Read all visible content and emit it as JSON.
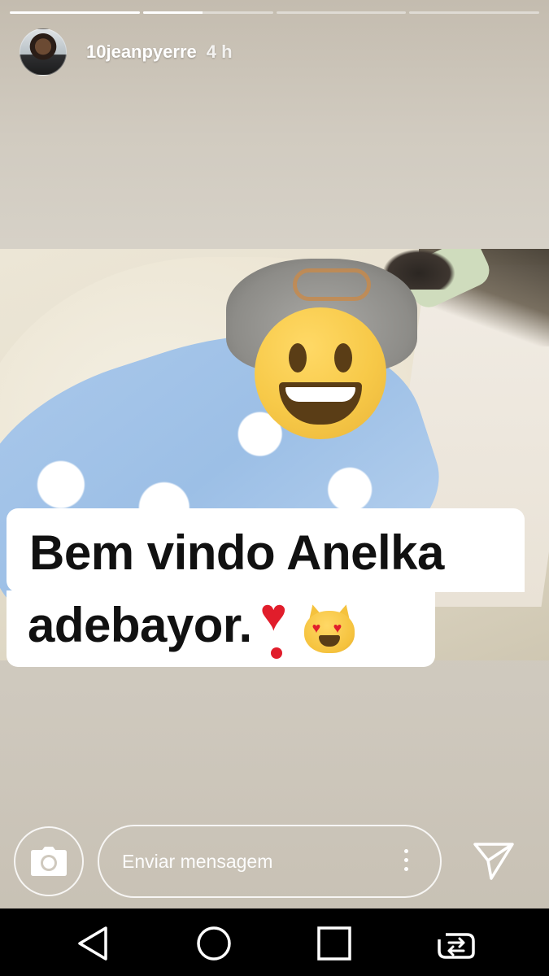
{
  "story": {
    "progress": [
      1.0,
      0.46,
      0.0,
      0.0
    ],
    "username": "10jeanpyerre",
    "time_ago": "4 h"
  },
  "caption": {
    "line1": "Bem vindo Anelka",
    "line2": "adebayor."
  },
  "stickers": [
    "grinning-face-emoji",
    "heart-exclamation-emoji",
    "heart-eyes-cat-emoji"
  ],
  "reply": {
    "placeholder": "Enviar mensagem"
  },
  "icons": {
    "camera": "camera-icon",
    "more": "more-vertical-icon",
    "send": "send-icon",
    "back": "back-triangle-icon",
    "home": "home-circle-icon",
    "recents": "recents-square-icon",
    "switch": "switch-apps-icon"
  },
  "colors": {
    "caption_bg": "#ffffff",
    "caption_text": "#111111",
    "heart": "#e11d2b",
    "emoji_yellow": "#f7c948",
    "navbar": "#000000"
  }
}
